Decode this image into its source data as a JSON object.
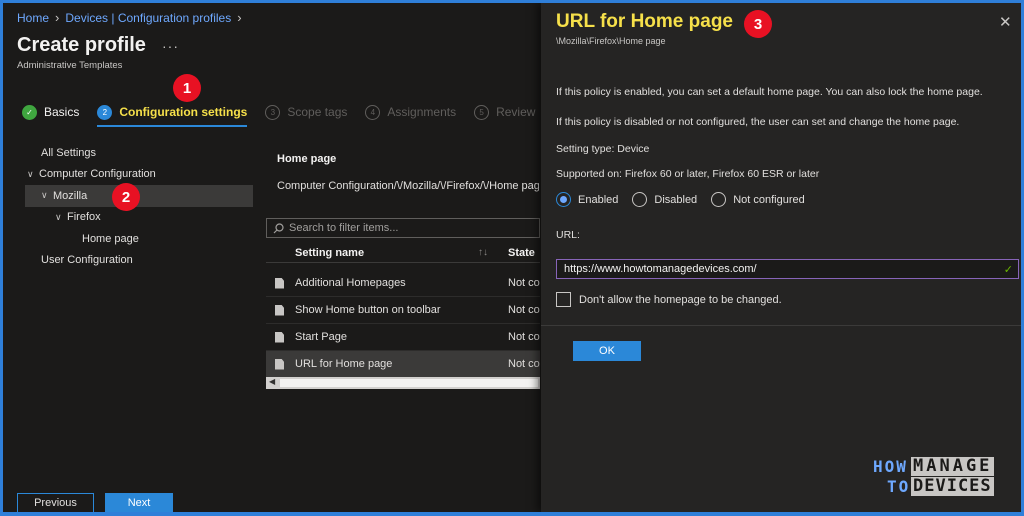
{
  "breadcrumb": [
    {
      "label": "Home"
    },
    {
      "label": "Devices | Configuration profiles"
    }
  ],
  "page": {
    "title": "Create profile",
    "subtitle": "Administrative Templates",
    "more_glyph": "···"
  },
  "steps": [
    {
      "label": "Basics",
      "state": "done",
      "glyph": "✓"
    },
    {
      "label": "Configuration settings",
      "state": "active",
      "glyph": "2"
    },
    {
      "label": "Scope tags",
      "state": "inactive",
      "glyph": "3"
    },
    {
      "label": "Assignments",
      "state": "inactive",
      "glyph": "4"
    },
    {
      "label": "Review",
      "state": "inactive",
      "glyph": "5"
    }
  ],
  "markers": [
    "1",
    "2",
    "3"
  ],
  "tree": {
    "all": "All Settings",
    "computer": "Computer Configuration",
    "mozilla": "Mozilla",
    "firefox": "Firefox",
    "homepage": "Home page",
    "user": "User Configuration"
  },
  "middle": {
    "header": "Home page",
    "path": "Computer Configuration/\\/Mozilla/\\/Firefox/\\/Home page",
    "filter_placeholder": "Search to filter items...",
    "col_name": "Setting name",
    "col_sort": "↑↓",
    "col_state": "State",
    "rows": [
      {
        "name": "Additional Homepages",
        "state": "Not co"
      },
      {
        "name": "Show Home button on toolbar",
        "state": "Not co"
      },
      {
        "name": "Start Page",
        "state": "Not co"
      },
      {
        "name": "URL for Home page",
        "state": "Not co"
      }
    ]
  },
  "footer": {
    "previous": "Previous",
    "next": "Next"
  },
  "panel": {
    "title": "URL for Home page",
    "path": "\\Mozilla\\Firefox\\Home page",
    "close_glyph": "✕",
    "desc1": "If this policy is enabled, you can set a default home page. You can also lock the home page.",
    "desc2": "If this policy is disabled or not configured, the user can set and change the home page.",
    "setting_type": "Setting type: Device",
    "supported": "Supported on: Firefox 60 or later, Firefox 60 ESR or later",
    "radio_enabled": "Enabled",
    "radio_disabled": "Disabled",
    "radio_not_configured": "Not configured",
    "selected_state": "Enabled",
    "url_label": "URL:",
    "url_value": "https://www.howtomanagedevices.com/",
    "lock_label": "Don't allow the homepage to be changed.",
    "ok": "OK"
  },
  "logo": {
    "how": "HOW",
    "to": "TO",
    "manage": "MANAGE",
    "devices": "DEVICES"
  },
  "colors": {
    "accent": "#2b88d8",
    "highlight": "#f6e04a",
    "marker": "#e81123",
    "success": "#3fa63f"
  }
}
